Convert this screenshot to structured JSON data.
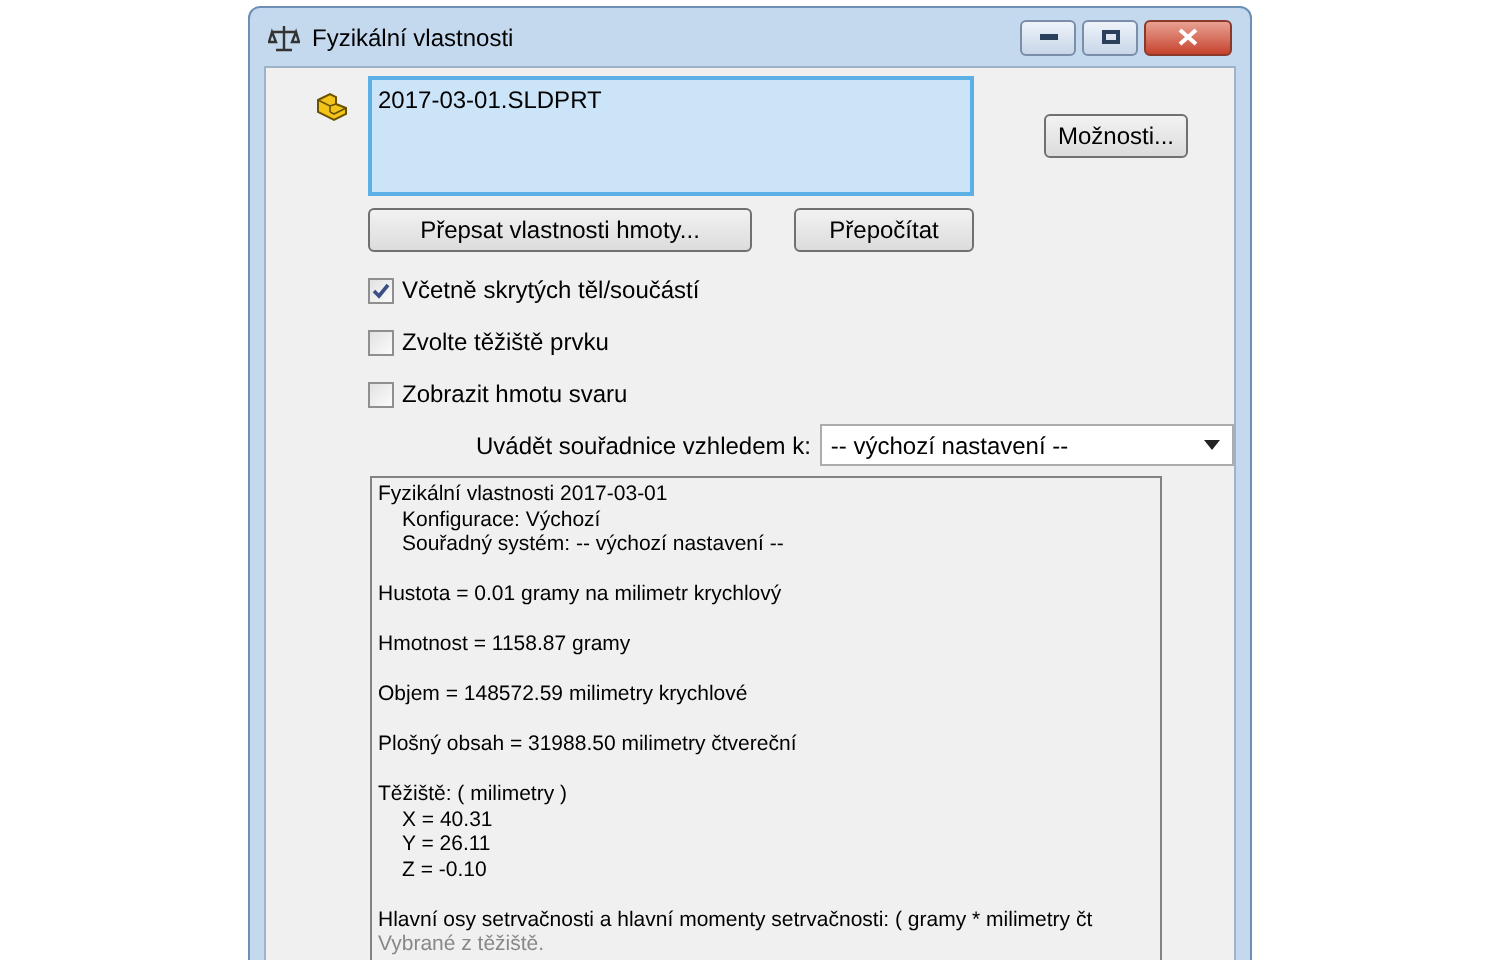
{
  "window": {
    "title": "Fyzikální vlastnosti"
  },
  "selection_list": {
    "items": [
      {
        "label": "2017-03-01.SLDPRT",
        "selected": false
      }
    ]
  },
  "buttons": {
    "options": "Možnosti...",
    "override": "Přepsat vlastnosti hmoty...",
    "recalculate": "Přepočítat"
  },
  "checkboxes": [
    {
      "label": "Včetně skrytých těl/součástí",
      "checked": true
    },
    {
      "label": "Zvolte těžiště prvku",
      "checked": false
    },
    {
      "label": "Zobrazit hmotu svaru",
      "checked": false
    }
  ],
  "coordinates": {
    "label": "Uvádět souřadnice vzhledem k:",
    "value": "-- výchozí nastavení --"
  },
  "results": [
    {
      "text": "Fyzikální vlastnosti 2017-03-01",
      "children": [
        {
          "text": "Konfigurace: Výchozí"
        },
        {
          "text": "Souřadný systém: -- výchozí nastavení --"
        }
      ]
    },
    {
      "text": "Hustota = 0.01 gramy na  milimetr krychlový"
    },
    {
      "text": "Hmotnost = 1158.87 gramy"
    },
    {
      "text": "Objem = 148572.59 milimetry krychlové"
    },
    {
      "text": "Plošný obsah = 31988.50  milimetry čtvereční"
    },
    {
      "text": "Těžiště: ( milimetry )",
      "children": [
        {
          "text": "X = 40.31"
        },
        {
          "text": "Y = 26.11"
        },
        {
          "text": "Z = -0.10"
        }
      ]
    },
    {
      "text": "Hlavní osy setrvačnosti a hlavní momenty setrvačnosti: ( gramy *  milimetry čt",
      "lines": [
        {
          "text": "Vybrané z těžiště."
        }
      ]
    }
  ]
}
